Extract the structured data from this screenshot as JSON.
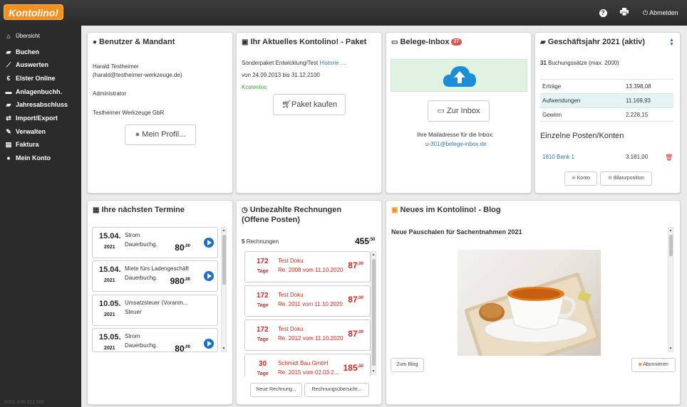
{
  "app": {
    "logo_text": "Kontolino!",
    "logout_label": "Abmelden",
    "version": "0001 GW 012 MS"
  },
  "sidebar": {
    "items": [
      {
        "label": "Übersicht",
        "icon": "home-icon"
      },
      {
        "label": "Buchen",
        "icon": "book-icon"
      },
      {
        "label": "Auswerten",
        "icon": "chart-icon"
      },
      {
        "label": "Elster Online",
        "icon": "elster-icon"
      },
      {
        "label": "Anlagenbuchh.",
        "icon": "truck-icon"
      },
      {
        "label": "Jahresabschluss",
        "icon": "book-icon"
      },
      {
        "label": "Import/Export",
        "icon": "exchange-icon"
      },
      {
        "label": "Verwalten",
        "icon": "wrench-icon"
      },
      {
        "label": "Faktura",
        "icon": "file-icon"
      },
      {
        "label": "Mein Konto",
        "icon": "user-icon"
      }
    ]
  },
  "user_panel": {
    "title": "Benutzer & Mandant",
    "name": "Harald Testheimer",
    "email": "(harald@testheimer-werkzeuge.de)",
    "role": "Administrator",
    "company": "Testheimer Werkzeuge GbR",
    "profile_button": "Mein Profil..."
  },
  "package_panel": {
    "title": "Ihr Aktuelles Kontolino! - Paket",
    "package": "Sonderpaket Entwicklung/Test",
    "history_link": "Historie ...",
    "period": "von 24.09.2013 bis 31.12.2100",
    "status": "Kostenlos",
    "buy_button": "Paket kaufen"
  },
  "inbox_panel": {
    "title": "Belege-Inbox",
    "badge": "27",
    "button": "Zur Inbox",
    "mail_label": "Ihre Mailadresse für die Inbox:",
    "mail_address": "u-301@belege-inbox.de"
  },
  "fiscal_panel": {
    "title": "Geschäftsjahr 2021 (aktiv)",
    "count": "31",
    "count_text": "Buchungssätze (max. 2000)",
    "rows": [
      {
        "label": "Erträge",
        "value": "13.398,08"
      },
      {
        "label": "Aufwendungen",
        "value": "11.169,93"
      },
      {
        "label": "Gewinn",
        "value": "2.228,15"
      }
    ],
    "section_title": "Einzelne Posten/Konten",
    "account": {
      "label": "1810 Bank 1",
      "value": "3.181,00"
    },
    "btn_konto": "Konto",
    "btn_bilanz": "Bilanzposition"
  },
  "appointments_panel": {
    "title": "Ihre nächsten Termine",
    "items": [
      {
        "date": "15.04.",
        "year": "2021",
        "name": "Strom",
        "sub": "Dauerbuchg.",
        "amount": "80",
        "cents": ",00"
      },
      {
        "date": "15.04.",
        "year": "2021",
        "name": "Miete fürs Ladengeschäft",
        "sub": "Dauerbuchg.",
        "amount": "980",
        "cents": ",00"
      },
      {
        "date": "10.05.",
        "year": "2021",
        "name": "Umsatzsteuer (Voranm...",
        "sub": "Steuer",
        "amount": "",
        "cents": ""
      },
      {
        "date": "15.05.",
        "year": "2021",
        "name": "Strom",
        "sub": "Dauerbuchg.",
        "amount": "80",
        "cents": ",00"
      }
    ]
  },
  "invoices_panel": {
    "title_line1": "Unbezahlte Rechnungen",
    "title_line2": "(Offene Posten)",
    "count": "5",
    "count_text": "Rechnungen",
    "total": "455",
    "total_cents": ",50",
    "items": [
      {
        "days": "172",
        "tage": "Tage",
        "customer": "Test Doku",
        "ref": "Re. 2008 vom 11.10.2020",
        "amount": "87",
        "cents": ",00"
      },
      {
        "days": "172",
        "tage": "Tage",
        "customer": "Test Doku",
        "ref": "Re. 2011 vom 11.10.2020",
        "amount": "87",
        "cents": ",00"
      },
      {
        "days": "172",
        "tage": "Tage",
        "customer": "Test Doku",
        "ref": "Re. 2012 vom 11.10.2020",
        "amount": "87",
        "cents": ",00"
      },
      {
        "days": "30",
        "tage": "Tage",
        "customer": "Schmidt Bau GmbH",
        "ref": "Re. 2015 vom 02.03.2...",
        "amount": "185",
        "cents": ",50"
      }
    ],
    "btn_new": "Neue Rechnung...",
    "btn_overview": "Rechnungsübersicht..."
  },
  "blog_panel": {
    "title": "Neues im Kontolino! - Blog",
    "article_title": "Neue Pauschalen für Sachentnahmen 2021",
    "btn_blog": "Zum Blog",
    "btn_subscribe": "Abonnieren"
  },
  "colors": {
    "brand": "#f29122",
    "link": "#2a7ab0",
    "danger": "#d9261c",
    "play": "#1e6dc8",
    "inbox_bg": "#e0f3e3"
  }
}
